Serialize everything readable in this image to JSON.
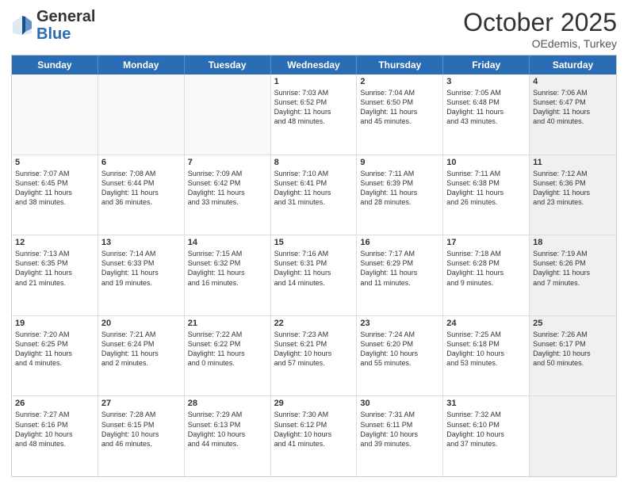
{
  "header": {
    "logo_line1": "General",
    "logo_line2": "Blue",
    "month": "October 2025",
    "location": "OEdemis, Turkey"
  },
  "weekdays": [
    "Sunday",
    "Monday",
    "Tuesday",
    "Wednesday",
    "Thursday",
    "Friday",
    "Saturday"
  ],
  "rows": [
    [
      {
        "day": "",
        "text": "",
        "empty": true
      },
      {
        "day": "",
        "text": "",
        "empty": true
      },
      {
        "day": "",
        "text": "",
        "empty": true
      },
      {
        "day": "1",
        "text": "Sunrise: 7:03 AM\nSunset: 6:52 PM\nDaylight: 11 hours\nand 48 minutes."
      },
      {
        "day": "2",
        "text": "Sunrise: 7:04 AM\nSunset: 6:50 PM\nDaylight: 11 hours\nand 45 minutes."
      },
      {
        "day": "3",
        "text": "Sunrise: 7:05 AM\nSunset: 6:48 PM\nDaylight: 11 hours\nand 43 minutes."
      },
      {
        "day": "4",
        "text": "Sunrise: 7:06 AM\nSunset: 6:47 PM\nDaylight: 11 hours\nand 40 minutes.",
        "shaded": true
      }
    ],
    [
      {
        "day": "5",
        "text": "Sunrise: 7:07 AM\nSunset: 6:45 PM\nDaylight: 11 hours\nand 38 minutes."
      },
      {
        "day": "6",
        "text": "Sunrise: 7:08 AM\nSunset: 6:44 PM\nDaylight: 11 hours\nand 36 minutes."
      },
      {
        "day": "7",
        "text": "Sunrise: 7:09 AM\nSunset: 6:42 PM\nDaylight: 11 hours\nand 33 minutes."
      },
      {
        "day": "8",
        "text": "Sunrise: 7:10 AM\nSunset: 6:41 PM\nDaylight: 11 hours\nand 31 minutes."
      },
      {
        "day": "9",
        "text": "Sunrise: 7:11 AM\nSunset: 6:39 PM\nDaylight: 11 hours\nand 28 minutes."
      },
      {
        "day": "10",
        "text": "Sunrise: 7:11 AM\nSunset: 6:38 PM\nDaylight: 11 hours\nand 26 minutes."
      },
      {
        "day": "11",
        "text": "Sunrise: 7:12 AM\nSunset: 6:36 PM\nDaylight: 11 hours\nand 23 minutes.",
        "shaded": true
      }
    ],
    [
      {
        "day": "12",
        "text": "Sunrise: 7:13 AM\nSunset: 6:35 PM\nDaylight: 11 hours\nand 21 minutes."
      },
      {
        "day": "13",
        "text": "Sunrise: 7:14 AM\nSunset: 6:33 PM\nDaylight: 11 hours\nand 19 minutes."
      },
      {
        "day": "14",
        "text": "Sunrise: 7:15 AM\nSunset: 6:32 PM\nDaylight: 11 hours\nand 16 minutes."
      },
      {
        "day": "15",
        "text": "Sunrise: 7:16 AM\nSunset: 6:31 PM\nDaylight: 11 hours\nand 14 minutes."
      },
      {
        "day": "16",
        "text": "Sunrise: 7:17 AM\nSunset: 6:29 PM\nDaylight: 11 hours\nand 11 minutes."
      },
      {
        "day": "17",
        "text": "Sunrise: 7:18 AM\nSunset: 6:28 PM\nDaylight: 11 hours\nand 9 minutes."
      },
      {
        "day": "18",
        "text": "Sunrise: 7:19 AM\nSunset: 6:26 PM\nDaylight: 11 hours\nand 7 minutes.",
        "shaded": true
      }
    ],
    [
      {
        "day": "19",
        "text": "Sunrise: 7:20 AM\nSunset: 6:25 PM\nDaylight: 11 hours\nand 4 minutes."
      },
      {
        "day": "20",
        "text": "Sunrise: 7:21 AM\nSunset: 6:24 PM\nDaylight: 11 hours\nand 2 minutes."
      },
      {
        "day": "21",
        "text": "Sunrise: 7:22 AM\nSunset: 6:22 PM\nDaylight: 11 hours\nand 0 minutes."
      },
      {
        "day": "22",
        "text": "Sunrise: 7:23 AM\nSunset: 6:21 PM\nDaylight: 10 hours\nand 57 minutes."
      },
      {
        "day": "23",
        "text": "Sunrise: 7:24 AM\nSunset: 6:20 PM\nDaylight: 10 hours\nand 55 minutes."
      },
      {
        "day": "24",
        "text": "Sunrise: 7:25 AM\nSunset: 6:18 PM\nDaylight: 10 hours\nand 53 minutes."
      },
      {
        "day": "25",
        "text": "Sunrise: 7:26 AM\nSunset: 6:17 PM\nDaylight: 10 hours\nand 50 minutes.",
        "shaded": true
      }
    ],
    [
      {
        "day": "26",
        "text": "Sunrise: 7:27 AM\nSunset: 6:16 PM\nDaylight: 10 hours\nand 48 minutes."
      },
      {
        "day": "27",
        "text": "Sunrise: 7:28 AM\nSunset: 6:15 PM\nDaylight: 10 hours\nand 46 minutes."
      },
      {
        "day": "28",
        "text": "Sunrise: 7:29 AM\nSunset: 6:13 PM\nDaylight: 10 hours\nand 44 minutes."
      },
      {
        "day": "29",
        "text": "Sunrise: 7:30 AM\nSunset: 6:12 PM\nDaylight: 10 hours\nand 41 minutes."
      },
      {
        "day": "30",
        "text": "Sunrise: 7:31 AM\nSunset: 6:11 PM\nDaylight: 10 hours\nand 39 minutes."
      },
      {
        "day": "31",
        "text": "Sunrise: 7:32 AM\nSunset: 6:10 PM\nDaylight: 10 hours\nand 37 minutes."
      },
      {
        "day": "",
        "text": "",
        "empty": true,
        "shaded": true
      }
    ]
  ]
}
